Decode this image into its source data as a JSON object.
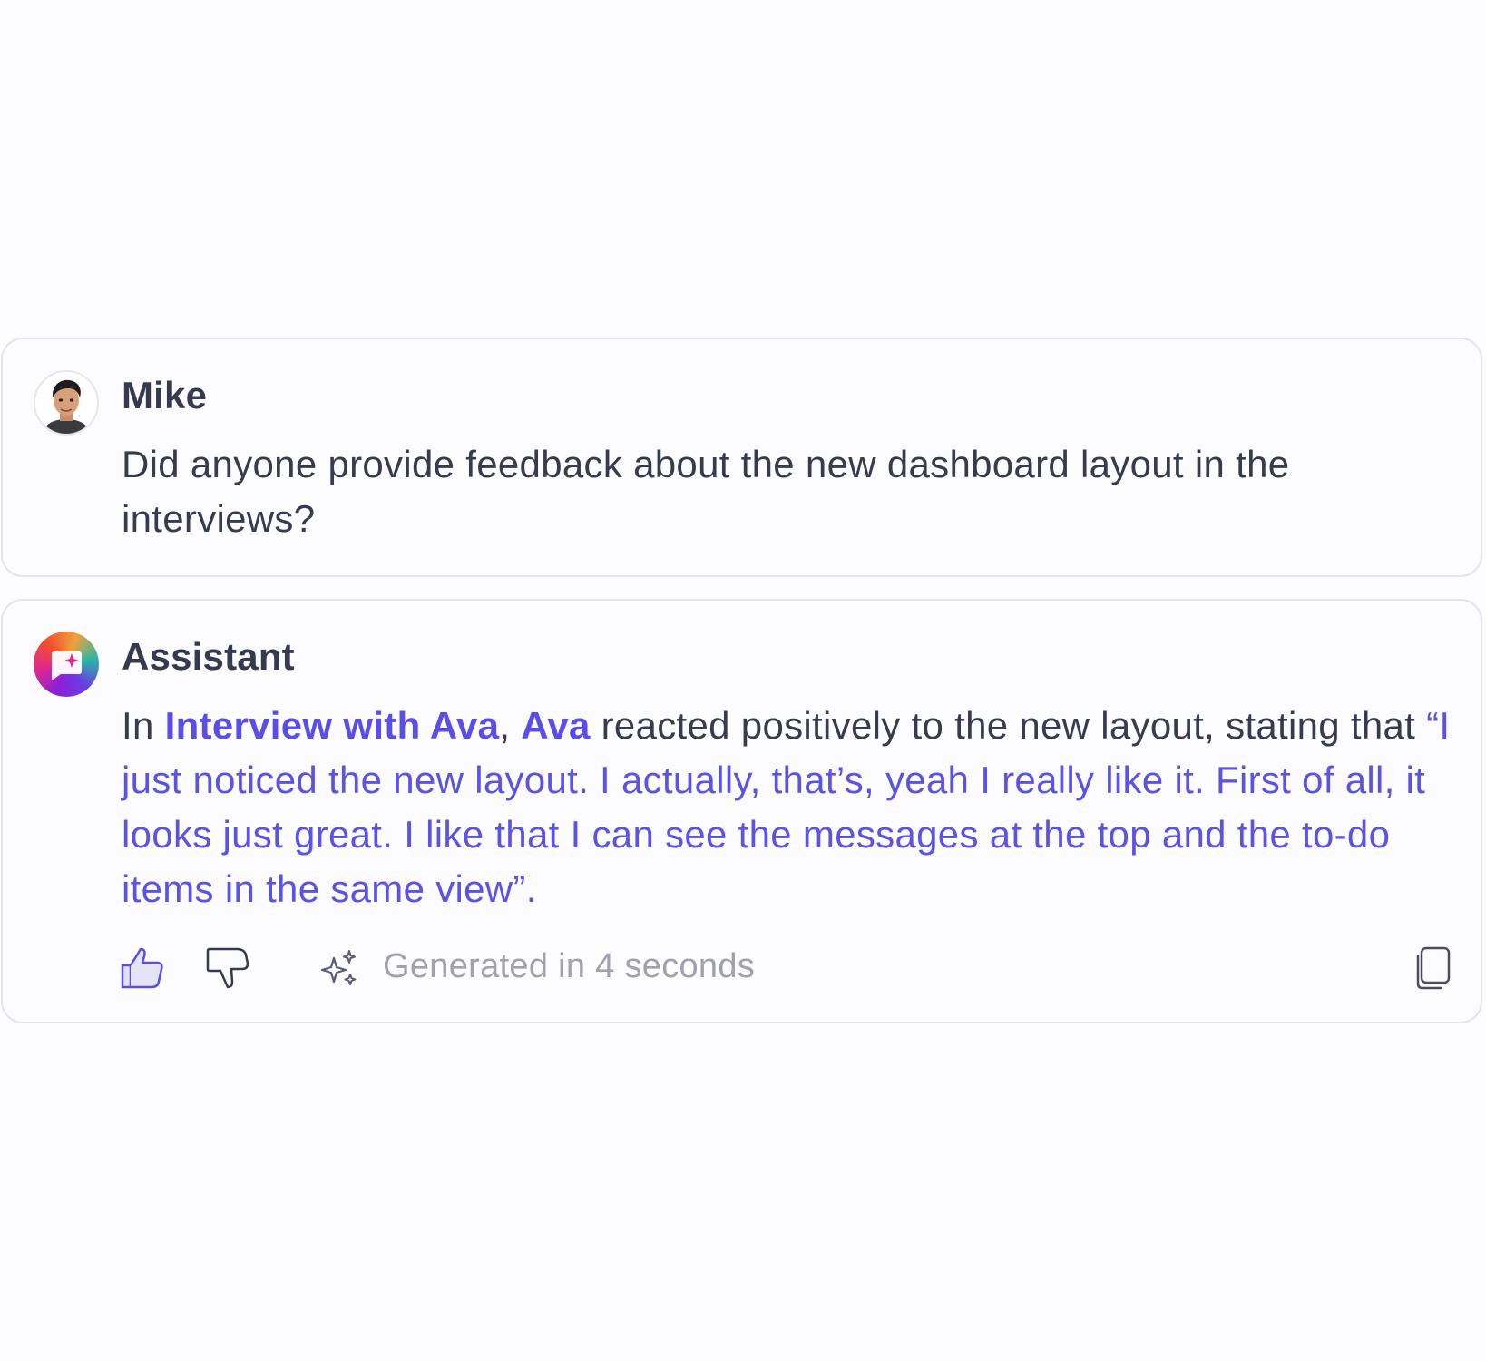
{
  "user_message": {
    "author": "Mike",
    "text": "Did anyone provide feedback about the new dashboard layout in the interviews?"
  },
  "assistant_message": {
    "author": "Assistant",
    "prefix": "In ",
    "source_link": "Interview with Ava",
    "separator": ", ",
    "person_link": "Ava",
    "middle": " reacted positively to the new layout, stating that ",
    "quote": "“I just noticed the new layout. I actually, that’s, yeah I really like it. First of all, it looks just great. I like that I can see the messages at the top and the to-do items in the same view”.",
    "generated_text": "Generated in 4 seconds"
  },
  "colors": {
    "link": "#5a4de8",
    "thumbs_up_fill": "#e5e3fb"
  },
  "icons": [
    "thumbs-up-icon",
    "thumbs-down-icon",
    "sparkle-icon",
    "copy-icon"
  ]
}
